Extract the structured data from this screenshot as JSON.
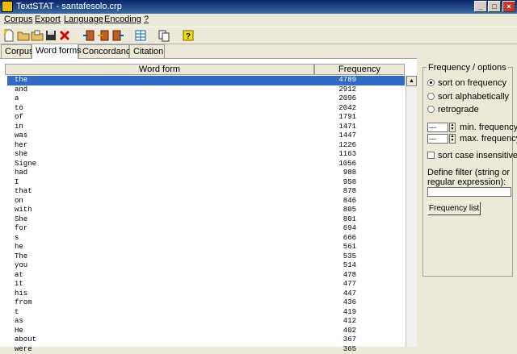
{
  "window": {
    "title": "TextSTAT - santafesolo.crp"
  },
  "menu": [
    "Corpus",
    "Export",
    "Language",
    "Encoding",
    "?"
  ],
  "toolbar_icons": [
    "new-file-icon",
    "open-folder-icon",
    "open-file-icon",
    "save-icon",
    "delete-icon",
    "import-icon",
    "import-web-icon",
    "export-icon",
    "table-icon",
    "copy-icon",
    "help-icon"
  ],
  "tabs": [
    "Corpus",
    "Word forms",
    "Concordance",
    "Citation"
  ],
  "active_tab": "Word forms",
  "table": {
    "headers": [
      "Word form",
      "Frequency"
    ],
    "rows": [
      {
        "word": "the",
        "freq": "4789"
      },
      {
        "word": "and",
        "freq": "2912"
      },
      {
        "word": "a",
        "freq": "2096"
      },
      {
        "word": "to",
        "freq": "2042"
      },
      {
        "word": "of",
        "freq": "1791"
      },
      {
        "word": "in",
        "freq": "1471"
      },
      {
        "word": "was",
        "freq": "1447"
      },
      {
        "word": "her",
        "freq": "1226"
      },
      {
        "word": "she",
        "freq": "1163"
      },
      {
        "word": "Signe",
        "freq": "1056"
      },
      {
        "word": "had",
        "freq": "988"
      },
      {
        "word": "I",
        "freq": "958"
      },
      {
        "word": "that",
        "freq": "878"
      },
      {
        "word": "on",
        "freq": "846"
      },
      {
        "word": "with",
        "freq": "805"
      },
      {
        "word": "She",
        "freq": "801"
      },
      {
        "word": "for",
        "freq": "694"
      },
      {
        "word": "s",
        "freq": "666"
      },
      {
        "word": "he",
        "freq": "561"
      },
      {
        "word": "The",
        "freq": "535"
      },
      {
        "word": "you",
        "freq": "514"
      },
      {
        "word": "at",
        "freq": "478"
      },
      {
        "word": "it",
        "freq": "477"
      },
      {
        "word": "his",
        "freq": "447"
      },
      {
        "word": "from",
        "freq": "436"
      },
      {
        "word": "t",
        "freq": "419"
      },
      {
        "word": "as",
        "freq": "412"
      },
      {
        "word": "He",
        "freq": "402"
      },
      {
        "word": "about",
        "freq": "367"
      },
      {
        "word": "were",
        "freq": "365"
      }
    ]
  },
  "options": {
    "title": "Frequency / options",
    "sort_frequency": "sort on frequency",
    "sort_alpha": "sort alphabetically",
    "retrograde": "retrograde",
    "min_value": "---",
    "min_label": "min. frequency",
    "max_value": "---",
    "max_label": "max. frequency",
    "case_label": "sort case insensitive",
    "filter_label": "Define filter (string or regular expression):",
    "button": "Frequency list"
  },
  "colors": {
    "title_bar": "#0a246a",
    "selection": "#316ac5",
    "background": "#ece9d8"
  }
}
